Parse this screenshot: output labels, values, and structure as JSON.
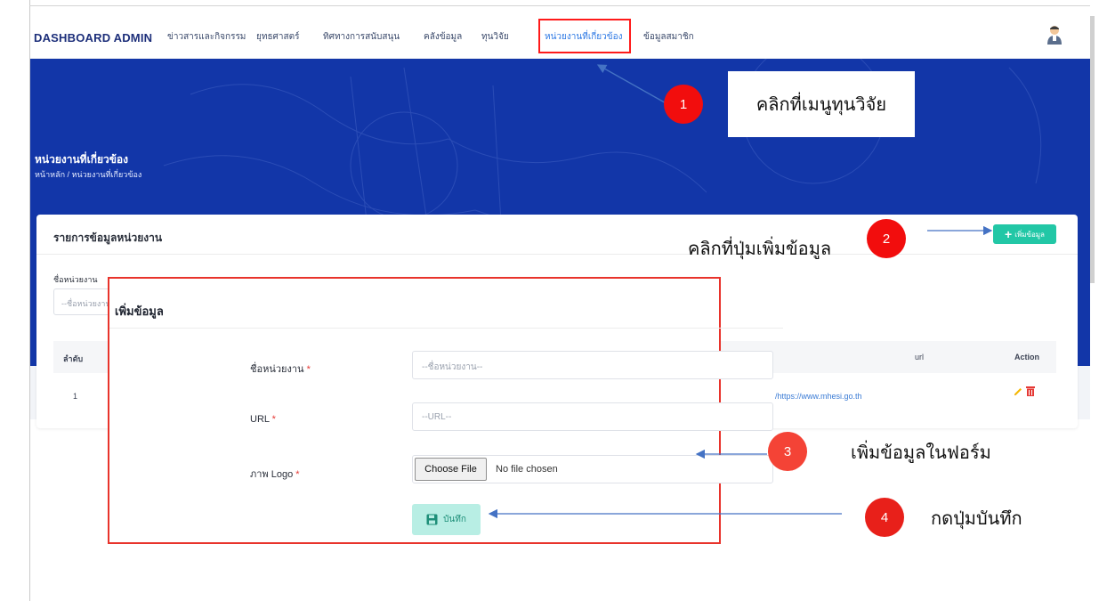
{
  "navbar": {
    "brand": "DASHBOARD ADMIN",
    "items": [
      {
        "label": "ข่าวสารและกิจกรรม"
      },
      {
        "label": "ยุทธศาสตร์"
      },
      {
        "label": "ทิศทางการสนับสนุน"
      },
      {
        "label": "คลังข้อมูล"
      },
      {
        "label": "ทุนวิจัย"
      },
      {
        "label": "หน่วยงานที่เกี่ยวข้อง",
        "active": true
      },
      {
        "label": "ข้อมูลสมาชิก"
      }
    ]
  },
  "hero": {
    "title": "หน่วยงานที่เกี่ยวข้อง",
    "breadcrumb": "หน้าหลัก / หน่วยงานที่เกี่ยวข้อง"
  },
  "card": {
    "title": "รายการข้อมูลหน่วยงาน",
    "add_label": "เพิ่มข้อมูล",
    "filter_label": "ชื่อหน่วยงาน",
    "filter_placeholder": "--ชื่อหน่วยงาน--",
    "columns": [
      "ลำดับ",
      "url",
      "Action"
    ],
    "rows": [
      {
        "no": "1",
        "url": "https://www.mhesi.go.th/"
      }
    ]
  },
  "modal": {
    "title": "เพิ่มข้อมูล",
    "name_label": "ชื่อหน่วยงาน",
    "name_placeholder": "--ชื่อหน่วยงาน--",
    "url_label": "URL",
    "url_placeholder": "--URL--",
    "logo_label": "ภาพ Logo",
    "required_mark": "*",
    "choose_file": "Choose File",
    "no_file": "No file chosen",
    "save_label": "บันทึก"
  },
  "annotations": {
    "step1_number": "1",
    "step1_text": "คลิกที่เมนูทุนวิจัย",
    "step2_number": "2",
    "step2_text": "คลิกที่ปุ่มเพิ่มข้อมูล",
    "step3_number": "3",
    "step3_text": "เพิ่มข้อมูลในฟอร์ม",
    "step4_number": "4",
    "step4_text": "กดปุ่มบันทึก"
  },
  "colors": {
    "hero": "#1236a8",
    "accent": "#22c7a6",
    "annotation_red": "#f20d0d",
    "arrow_blue": "#4472c4"
  }
}
